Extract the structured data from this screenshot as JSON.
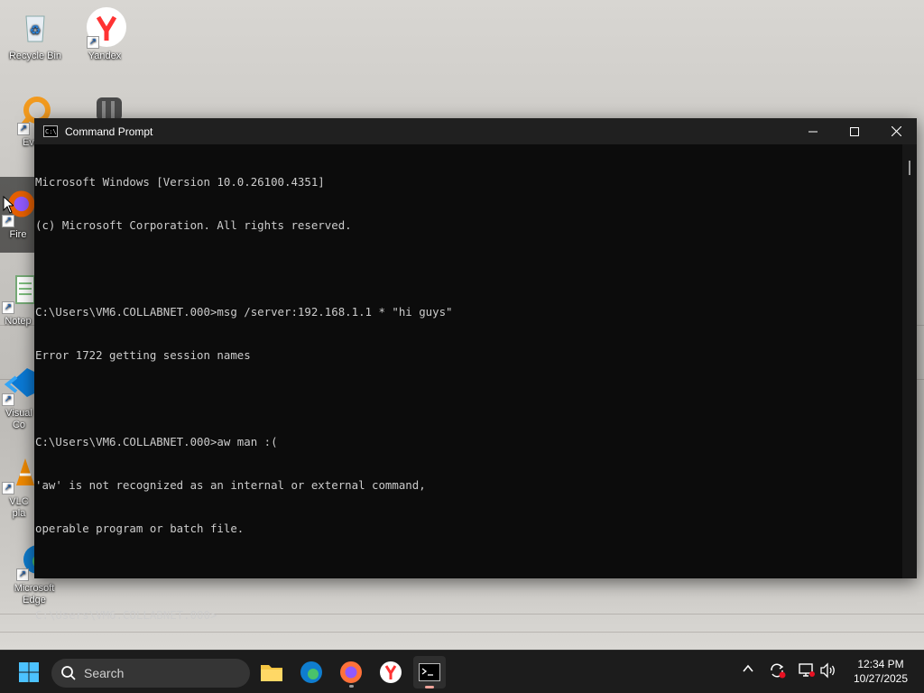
{
  "desktop": {
    "icons": [
      {
        "label": "Recycle Bin",
        "icon": "recycle-bin-icon"
      },
      {
        "label": "Yandex",
        "icon": "yandex-icon"
      },
      {
        "label": "Every",
        "icon": "everything-search-icon"
      },
      {
        "label": "Fire",
        "icon": "firefox-icon"
      },
      {
        "label": "Notep",
        "icon": "notepad-icon"
      },
      {
        "label": "Visual\nCo",
        "icon": "vscode-icon"
      },
      {
        "label": "VLC\npla",
        "icon": "vlc-icon"
      },
      {
        "label": "Microsoft\nEdge",
        "icon": "edge-icon"
      }
    ]
  },
  "window": {
    "title": "Command Prompt",
    "controls": {
      "minimize": "—",
      "maximize": "☐",
      "close": "✕"
    },
    "console_lines": [
      "Microsoft Windows [Version 10.0.26100.4351]",
      "(c) Microsoft Corporation. All rights reserved.",
      "",
      "C:\\Users\\VM6.COLLABNET.000>msg /server:192.168.1.1 * \"hi guys\"",
      "Error 1722 getting session names",
      "",
      "C:\\Users\\VM6.COLLABNET.000>aw man :(",
      "'aw' is not recognized as an internal or external command,",
      "operable program or batch file.",
      "",
      "C:\\Users\\VM6.COLLABNET.000>"
    ]
  },
  "taskbar": {
    "search_placeholder": "Search",
    "apps": [
      "file-explorer-icon",
      "edge-icon",
      "firefox-icon",
      "yandex-icon",
      "command-prompt-icon"
    ],
    "tray": {
      "chevron": "^"
    },
    "clock": {
      "time": "12:34 PM",
      "date": "10/27/2025"
    }
  },
  "colors": {
    "console_bg": "#0c0c0c",
    "console_text": "#cccccc",
    "taskbar_bg": "#1c1c1c",
    "accent_indicator": "#f0a39a"
  }
}
